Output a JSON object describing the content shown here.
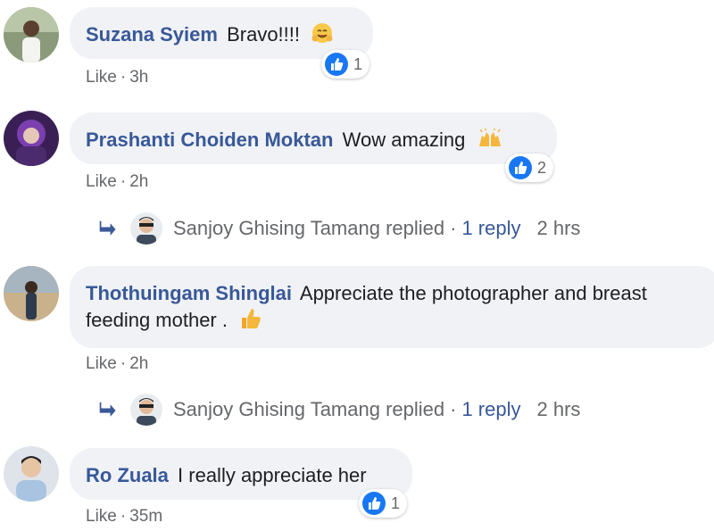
{
  "comments": [
    {
      "name": "Suzana Syiem",
      "text": "Bravo!!!!",
      "emoji_icon": "hugging-face-icon",
      "reaction_count": "1",
      "like_label": "Like",
      "time": "3h"
    },
    {
      "name": "Prashanti Choiden Moktan",
      "text": "Wow amazing",
      "emoji_icon": "raising-hands-icon",
      "reaction_count": "2",
      "like_label": "Like",
      "time": "2h",
      "reply": {
        "author": "Sanjoy Ghising Tamang replied",
        "count": "1 reply",
        "time": "2 hrs"
      }
    },
    {
      "name": "Thothuingam Shinglai",
      "text_line1": "Appreciate the photographer and breast",
      "text_line2": "feeding mother .",
      "emoji_icon": "thumbs-up-emoji-icon",
      "like_label": "Like",
      "time": "2h",
      "reply": {
        "author": "Sanjoy Ghising Tamang replied",
        "count": "1 reply",
        "time": "2 hrs"
      }
    },
    {
      "name": "Ro Zuala",
      "text": "I really appreciate her",
      "reaction_count": "1",
      "like_label": "Like",
      "time": "35m"
    }
  ],
  "colors": {
    "name_link": "#385898",
    "meta_text": "#65676b",
    "bubble_bg": "#f0f2f5",
    "like_blue": "#1877f2"
  }
}
